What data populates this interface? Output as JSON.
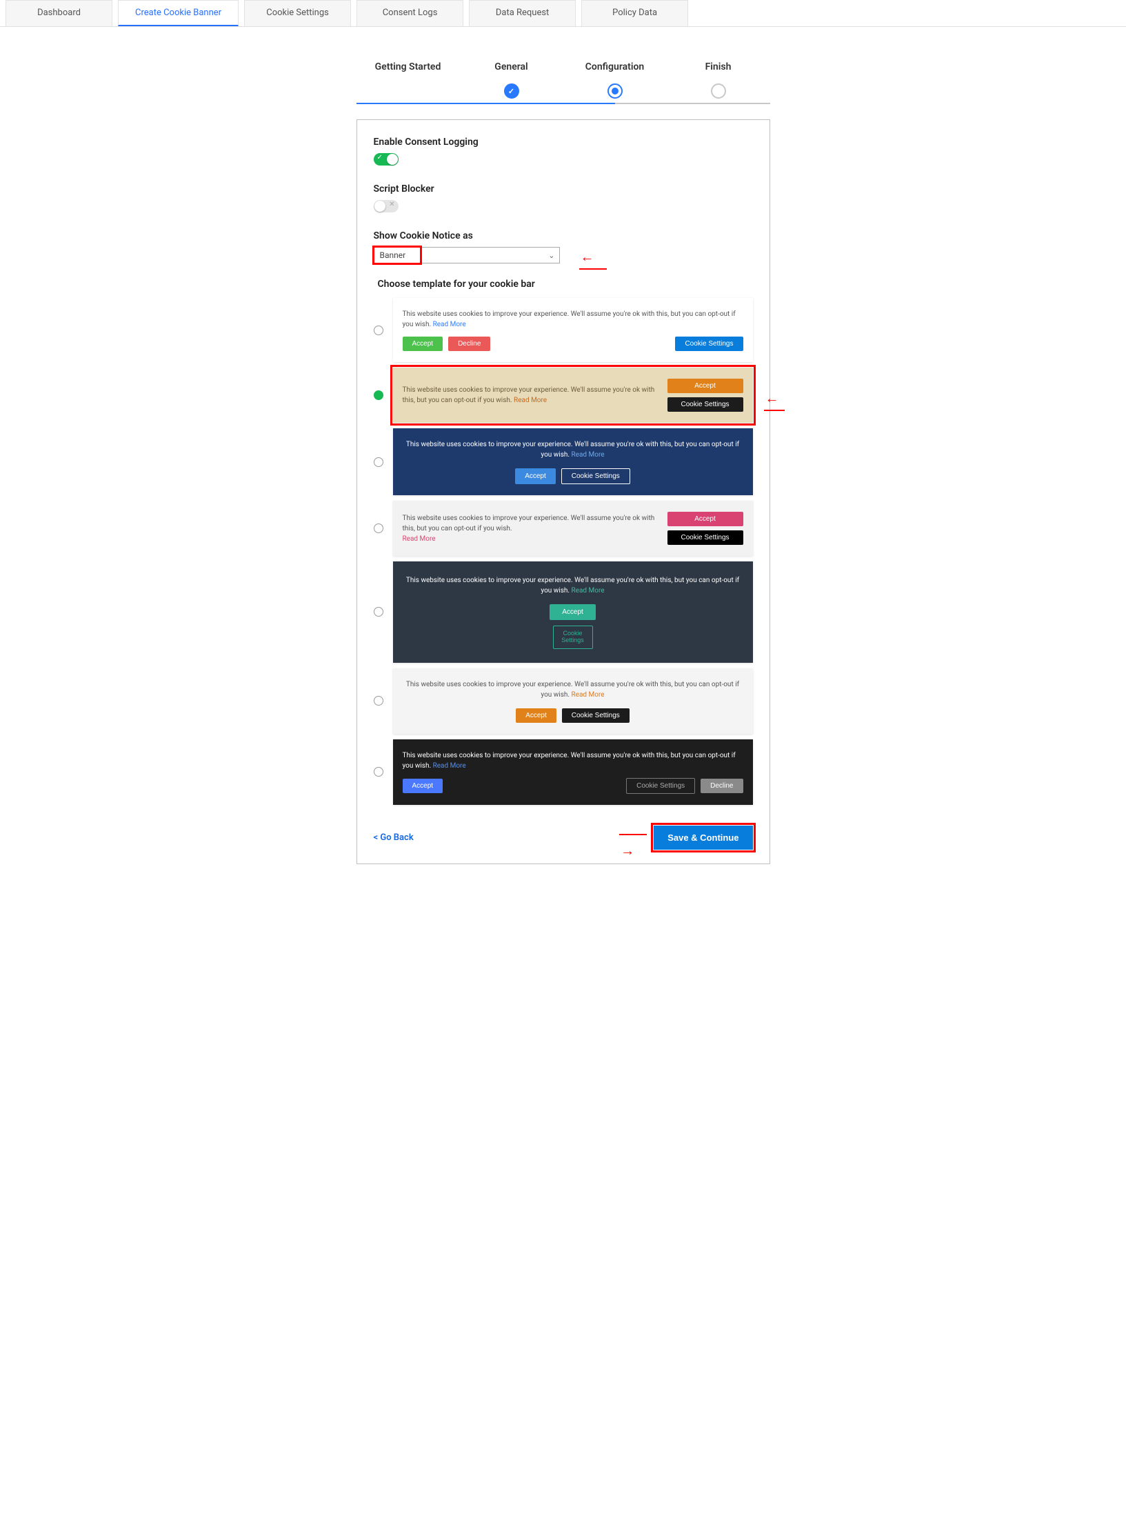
{
  "tabs": {
    "dashboard": "Dashboard",
    "create_banner": "Create Cookie Banner",
    "cookie_settings": "Cookie Settings",
    "consent_logs": "Consent Logs",
    "data_request": "Data Request",
    "policy_data": "Policy Data"
  },
  "steps": {
    "getting_started": "Getting Started",
    "general": "General",
    "configuration": "Configuration",
    "finish": "Finish"
  },
  "fields": {
    "enable_consent_logging": "Enable Consent Logging",
    "script_blocker": "Script Blocker",
    "show_notice_as": "Show Cookie Notice as",
    "notice_value": "Banner",
    "choose_template": "Choose template for your cookie bar"
  },
  "template_text": {
    "body": "This website uses cookies to improve your experience. We'll assume you're ok with this, but you can opt-out if you wish.",
    "read_more": "Read More"
  },
  "buttons": {
    "accept": "Accept",
    "decline": "Decline",
    "cookie_settings": "Cookie Settings"
  },
  "footer": {
    "go_back": "<  Go Back",
    "save": "Save & Continue"
  }
}
